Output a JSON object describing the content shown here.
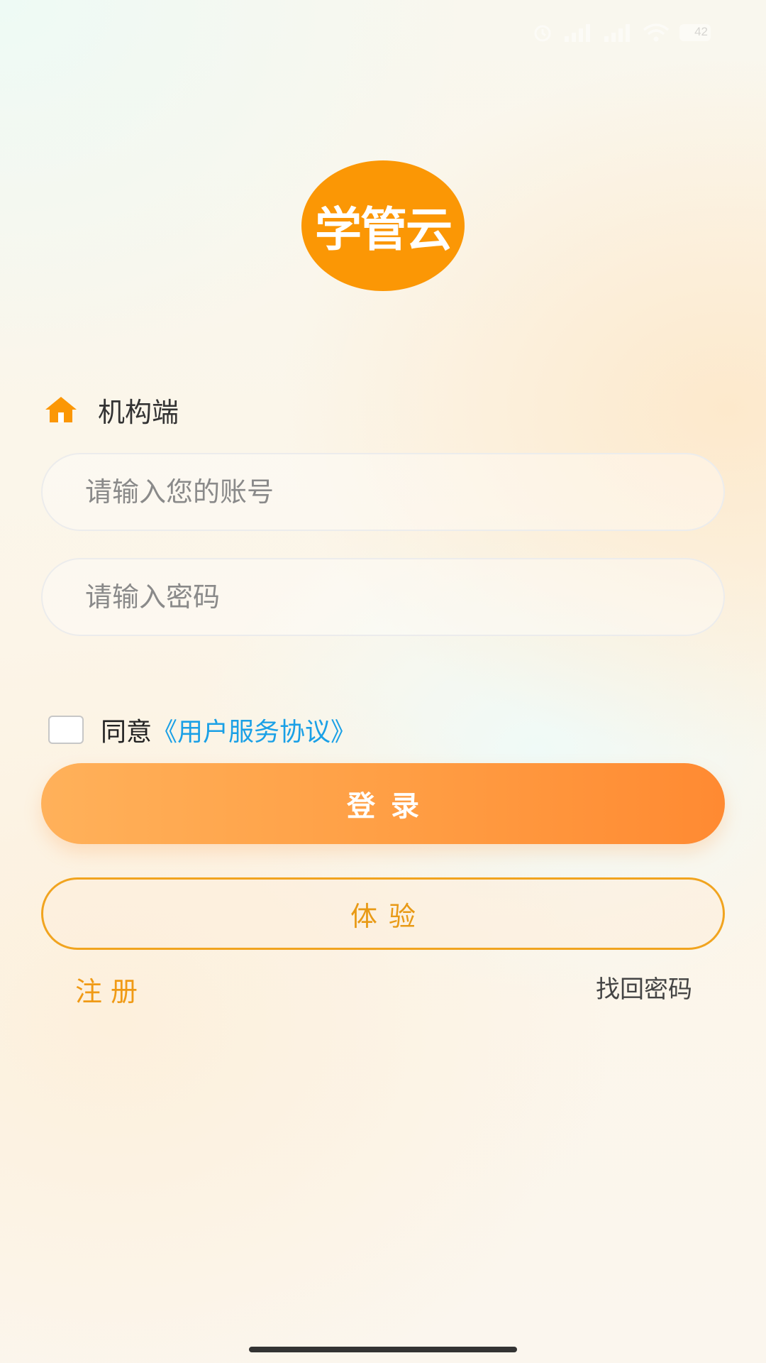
{
  "logo": {
    "text": "学管云",
    "color": "#fb9705"
  },
  "status_bar": {
    "battery": "42",
    "icons": [
      "alarm-icon",
      "signal-icon",
      "signal-icon",
      "wifi-icon",
      "battery-icon"
    ]
  },
  "role": {
    "icon": "home-icon",
    "label": "机构端"
  },
  "form": {
    "account_placeholder": "请输入您的账号",
    "account_value": "",
    "password_placeholder": "请输入密码",
    "password_value": ""
  },
  "agreement": {
    "checked": false,
    "prefix": "同意",
    "link": "《用户服务协议》",
    "link_color": "#1aa0e6"
  },
  "buttons": {
    "login": "登录",
    "trial": "体验",
    "register": "注册",
    "forgot": "找回密码"
  },
  "colors": {
    "accent": "#ff9f45",
    "trial_border": "#f1a41f"
  }
}
